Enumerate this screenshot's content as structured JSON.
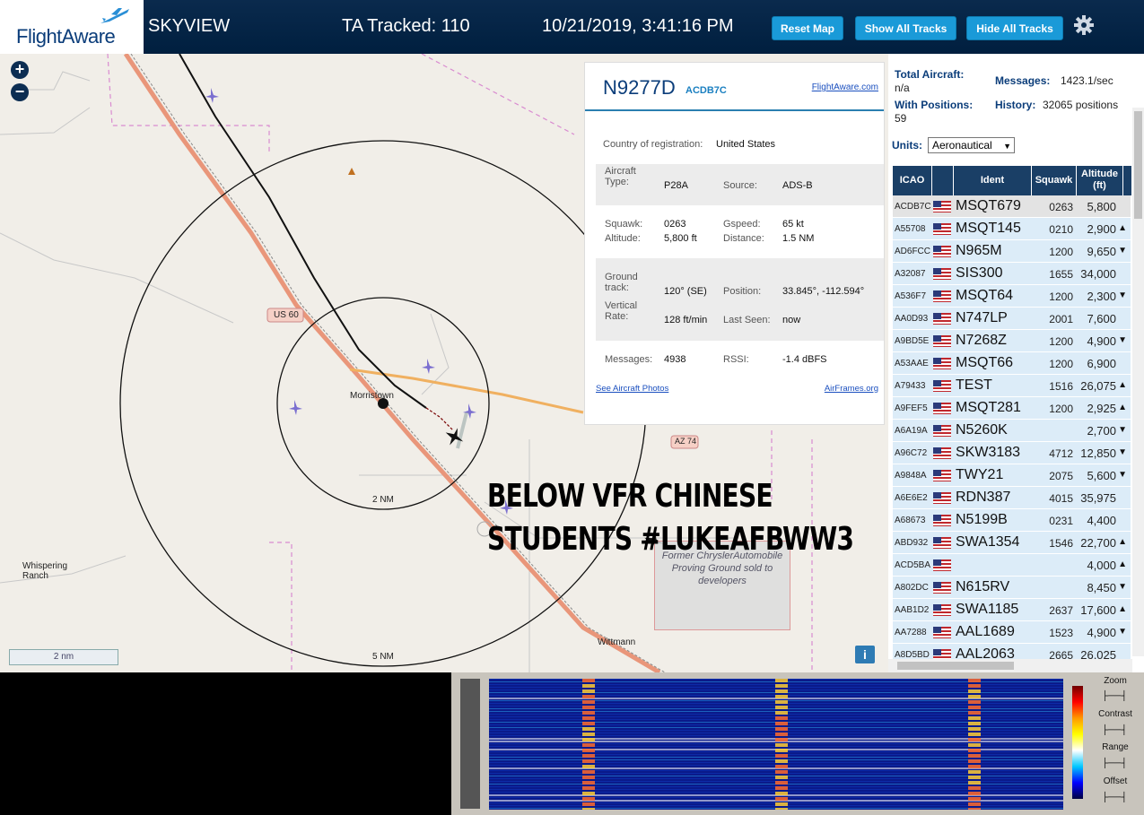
{
  "header": {
    "logo_text": "FlightAware",
    "app_name": "SKYVIEW",
    "tracked_label": "TA Tracked: 110",
    "datetime": "10/21/2019, 3:41:16 PM",
    "buttons": [
      "Reset Map",
      "Show All Tracks",
      "Hide All Tracks"
    ],
    "settings_icon": "gear-icon"
  },
  "map": {
    "zoom_in": "+",
    "zoom_out": "−",
    "scale_label": "2 nm",
    "labels": {
      "us60": "US 60",
      "morristown": "Morristown",
      "whispering": "Whispering Ranch",
      "wittmann": "Wittmann",
      "ring_2nm": "2 NM",
      "ring_5nm": "5 NM",
      "az74": "AZ 74"
    },
    "proving_ground": "Former ChryslerAutomobile Proving Ground sold to developers",
    "info_icon": "i",
    "caption_line1": "BELOW VFR CHINESE",
    "caption_line2": "STUDENTS #LUKEAFBWW3"
  },
  "detail": {
    "registration": "N9277D",
    "hex": "ACDB7C",
    "flightaware_link": "FlightAware.com",
    "country_label": "Country of registration:",
    "country_value": "United States",
    "aircraft_type_label": "Aircraft Type:",
    "aircraft_type_value": "P28A",
    "source_label": "Source:",
    "source_value": "ADS-B",
    "squawk_label": "Squawk:",
    "squawk_value": "0263",
    "altitude_label": "Altitude:",
    "altitude_value": "5,800 ft",
    "gspeed_label": "Gspeed:",
    "gspeed_value": "65 kt",
    "distance_label": "Distance:",
    "distance_value": "1.5 NM",
    "ground_track_label": "Ground track:",
    "ground_track_value": "120° (SE)",
    "position_label": "Position:",
    "position_value": "33.845°, -112.594°",
    "vertical_rate_label": "Vertical Rate:",
    "vertical_rate_value": "128 ft/min",
    "last_seen_label": "Last Seen:",
    "last_seen_value": "now",
    "messages_label": "Messages:",
    "messages_value": "4938",
    "rssi_label": "RSSI:",
    "rssi_value": "-1.4 dBFS",
    "photos_link": "See Aircraft Photos",
    "airframes_link": "AirFrames.org"
  },
  "sidebar": {
    "total_aircraft_label": "Total Aircraft:",
    "total_aircraft_value": "n/a",
    "messages_label": "Messages:",
    "messages_value": "1423.1/sec",
    "with_positions_label": "With Positions:",
    "with_positions_value": "59",
    "history_label": "History:",
    "history_value": "32065 positions",
    "units_label": "Units:",
    "units_value": "Aeronautical",
    "columns": [
      "ICAO",
      "",
      "Ident",
      "Squawk",
      "Altitude (ft)"
    ],
    "rows": [
      {
        "icao": "ACDB7C",
        "ident": "MSQT679",
        "squawk": "0263",
        "alt": "5,800",
        "trend": ""
      },
      {
        "icao": "A55708",
        "ident": "MSQT145",
        "squawk": "0210",
        "alt": "2,900",
        "trend": "▲"
      },
      {
        "icao": "AD6FCC",
        "ident": "N965M",
        "squawk": "1200",
        "alt": "9,650",
        "trend": "▼"
      },
      {
        "icao": "A32087",
        "ident": "SIS300",
        "squawk": "1655",
        "alt": "34,000",
        "trend": ""
      },
      {
        "icao": "A536F7",
        "ident": "MSQT64",
        "squawk": "1200",
        "alt": "2,300",
        "trend": "▼"
      },
      {
        "icao": "AA0D93",
        "ident": "N747LP",
        "squawk": "2001",
        "alt": "7,600",
        "trend": ""
      },
      {
        "icao": "A9BD5E",
        "ident": "N7268Z",
        "squawk": "1200",
        "alt": "4,900",
        "trend": "▼"
      },
      {
        "icao": "A53AAE",
        "ident": "MSQT66",
        "squawk": "1200",
        "alt": "6,900",
        "trend": ""
      },
      {
        "icao": "A79433",
        "ident": "TEST",
        "squawk": "1516",
        "alt": "26,075",
        "trend": "▲"
      },
      {
        "icao": "A9FEF5",
        "ident": "MSQT281",
        "squawk": "1200",
        "alt": "2,925",
        "trend": "▲"
      },
      {
        "icao": "A6A19A",
        "ident": "N5260K",
        "squawk": "",
        "alt": "2,700",
        "trend": "▼"
      },
      {
        "icao": "A96C72",
        "ident": "SKW3183",
        "squawk": "4712",
        "alt": "12,850",
        "trend": "▼"
      },
      {
        "icao": "A9848A",
        "ident": "TWY21",
        "squawk": "2075",
        "alt": "5,600",
        "trend": "▼"
      },
      {
        "icao": "A6E6E2",
        "ident": "RDN387",
        "squawk": "4015",
        "alt": "35,975",
        "trend": ""
      },
      {
        "icao": "A68673",
        "ident": "N5199B",
        "squawk": "0231",
        "alt": "4,400",
        "trend": ""
      },
      {
        "icao": "ABD932",
        "ident": "SWA1354",
        "squawk": "1546",
        "alt": "22,700",
        "trend": "▲"
      },
      {
        "icao": "ACD5BA",
        "ident": "",
        "squawk": "",
        "alt": "4,000",
        "trend": "▲"
      },
      {
        "icao": "A802DC",
        "ident": "N615RV",
        "squawk": "",
        "alt": "8,450",
        "trend": "▼"
      },
      {
        "icao": "AAB1D2",
        "ident": "SWA1185",
        "squawk": "2637",
        "alt": "17,600",
        "trend": "▲"
      },
      {
        "icao": "AA7288",
        "ident": "AAL1689",
        "squawk": "1523",
        "alt": "4,900",
        "trend": "▼"
      },
      {
        "icao": "A8D5BD",
        "ident": "AAL2063",
        "squawk": "2665",
        "alt": "26,025",
        "trend": ""
      }
    ]
  },
  "spectrum": {
    "controls": [
      "Zoom",
      "Contrast",
      "Range",
      "Offset"
    ]
  },
  "colors": {
    "header_bg": "#0a2a4d",
    "button_bg": "#1a9ad8",
    "table_header": "#1a3f66",
    "row_bg": "#dcecf8",
    "map_bg": "#f1eee8",
    "road_orange": "#e9967a",
    "aircraft_purple": "#7b6fd0"
  }
}
